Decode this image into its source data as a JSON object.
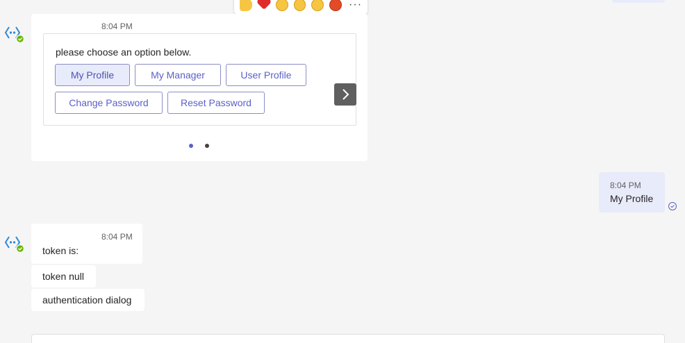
{
  "colors": {
    "background": "#f5f5f5",
    "bubble_bg": "#ffffff",
    "user_bubble_bg": "#e8ebfa",
    "accent": "#5b5fc7",
    "online_badge": "#6bb700",
    "bot_icon": "#2b88d8"
  },
  "reactions": [
    "like-icon",
    "heart-icon",
    "laugh-icon",
    "surprised-icon",
    "sad-icon",
    "angry-icon"
  ],
  "more_options_icon": "more-options-icon",
  "card_message": {
    "timestamp": "8:04 PM",
    "prompt": "please choose an option below.",
    "options": [
      {
        "label": "My Profile",
        "selected": true
      },
      {
        "label": "My Manager",
        "selected": false
      },
      {
        "label": "User Profile",
        "selected": false
      },
      {
        "label": "Change Password",
        "selected": false
      },
      {
        "label": "Reset Password",
        "selected": false
      }
    ],
    "carousel_page": 1,
    "carousel_total": 2
  },
  "user_message": {
    "timestamp": "8:04 PM",
    "text": "My Profile",
    "status": "sent"
  },
  "bot_reply": {
    "timestamp": "8:04 PM",
    "messages": [
      "token is:",
      "token null",
      "authentication dialog"
    ]
  }
}
